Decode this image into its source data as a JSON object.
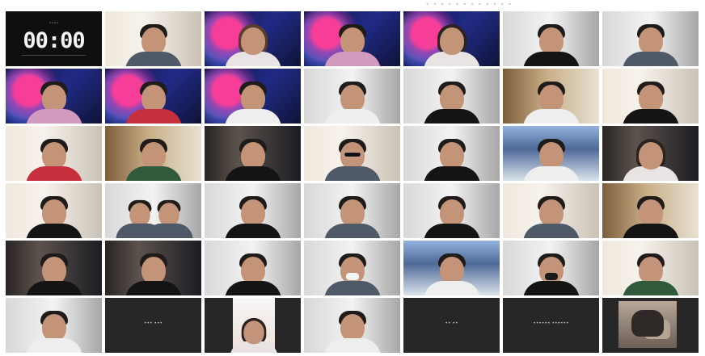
{
  "window": {
    "title": "• • • • • • • • • • • •"
  },
  "timer": {
    "caption": "••••",
    "value": "00:00"
  },
  "name_labels": [
    "••• •••",
    "•• ••",
    "•••••• ••••••"
  ],
  "colors": {
    "background": "#ffffff",
    "tile_dark": "#272727",
    "timer_text": "#f4f4f4",
    "label_text": "#bdbdbd"
  }
}
